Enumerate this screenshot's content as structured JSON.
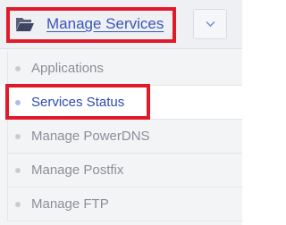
{
  "header": {
    "title": "Manage Services",
    "icon": "folder-open-icon",
    "toggle_icon": "chevron-down-icon"
  },
  "menu": {
    "items": [
      {
        "label": "Applications",
        "active": false
      },
      {
        "label": "Services Status",
        "active": true
      },
      {
        "label": "Manage PowerDNS",
        "active": false
      },
      {
        "label": "Manage Postfix",
        "active": false
      },
      {
        "label": "Manage FTP",
        "active": false
      }
    ]
  },
  "colors": {
    "accent": "#3a55b8",
    "highlight": "#e11a2b",
    "inactive_text": "#8a8f97"
  }
}
